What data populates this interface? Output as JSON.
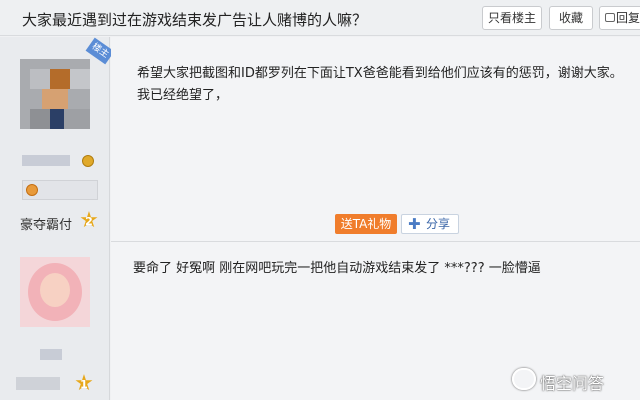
{
  "header": {
    "thread_title": "大家最近遇到过在游戏结束发广告让人赌博的人嘛？",
    "only_op_label": "只看楼主",
    "favorite_label": "收藏",
    "reply_label": "回复"
  },
  "post1": {
    "owner_badge": "楼主",
    "content": "希望大家把截图和ID都罗列在下面让TX爸爸能看到给他们应该有的惩罚，谢谢大家。我已经绝望了，",
    "rank_label": "豪夺霸付",
    "rank_level": "2",
    "gift_label": "送TA礼物",
    "share_label": "分享"
  },
  "post2": {
    "content": "要命了 好冤啊 刚在网吧玩完一把他自动游戏结束发了 ***??? 一脸懵逼",
    "rank_level": "1"
  },
  "watermark": {
    "text": "悟空问答"
  },
  "colors": {
    "accent_orange": "#f07d2c",
    "owner_badge_blue": "#5b8dd6",
    "star_gold": "#e7a81c"
  },
  "icons": {
    "reply": "reply-icon",
    "share": "plus-icon",
    "rank": "star-icon",
    "medal": "medal-icon"
  }
}
